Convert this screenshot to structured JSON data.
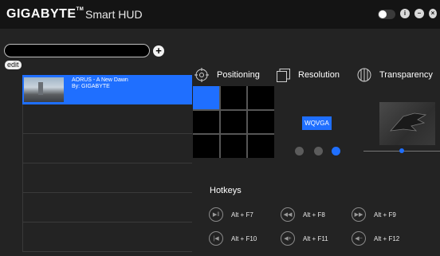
{
  "app": {
    "brand": "GIGABYTE",
    "trademark": "TM",
    "name": "Smart HUD"
  },
  "search": {
    "placeholder": "",
    "value": ""
  },
  "add_icon_glyph": "+",
  "edit_label": "edit",
  "playlist": {
    "selected": {
      "title": "AORUS - A New Dawn",
      "subtitle": "By: GIGABYTE"
    },
    "empty_slots": 5
  },
  "sections": {
    "positioning": "Positioning",
    "resolution": "Resolution",
    "transparency": "Transparency"
  },
  "positioning_grid": {
    "active_index": 0
  },
  "resolution": {
    "selected": "WQVGA",
    "dot_count": 3,
    "active_dot": 2
  },
  "transparency": {
    "level": 0.5
  },
  "hotkeys": {
    "title": "Hotkeys",
    "items": [
      {
        "icon": "play-pause-icon",
        "label": "Alt + F7"
      },
      {
        "icon": "rewind-icon",
        "label": "Alt + F8"
      },
      {
        "icon": "fast-forward-icon",
        "label": "Alt + F9"
      },
      {
        "icon": "previous-track-icon",
        "label": "Alt + F10"
      },
      {
        "icon": "volume-up-icon",
        "label": "Alt + F11"
      },
      {
        "icon": "volume-down-icon",
        "label": "Alt + F12"
      }
    ]
  },
  "colors": {
    "accent": "#1f6fff",
    "background": "#232323",
    "titlebar": "#141414"
  }
}
